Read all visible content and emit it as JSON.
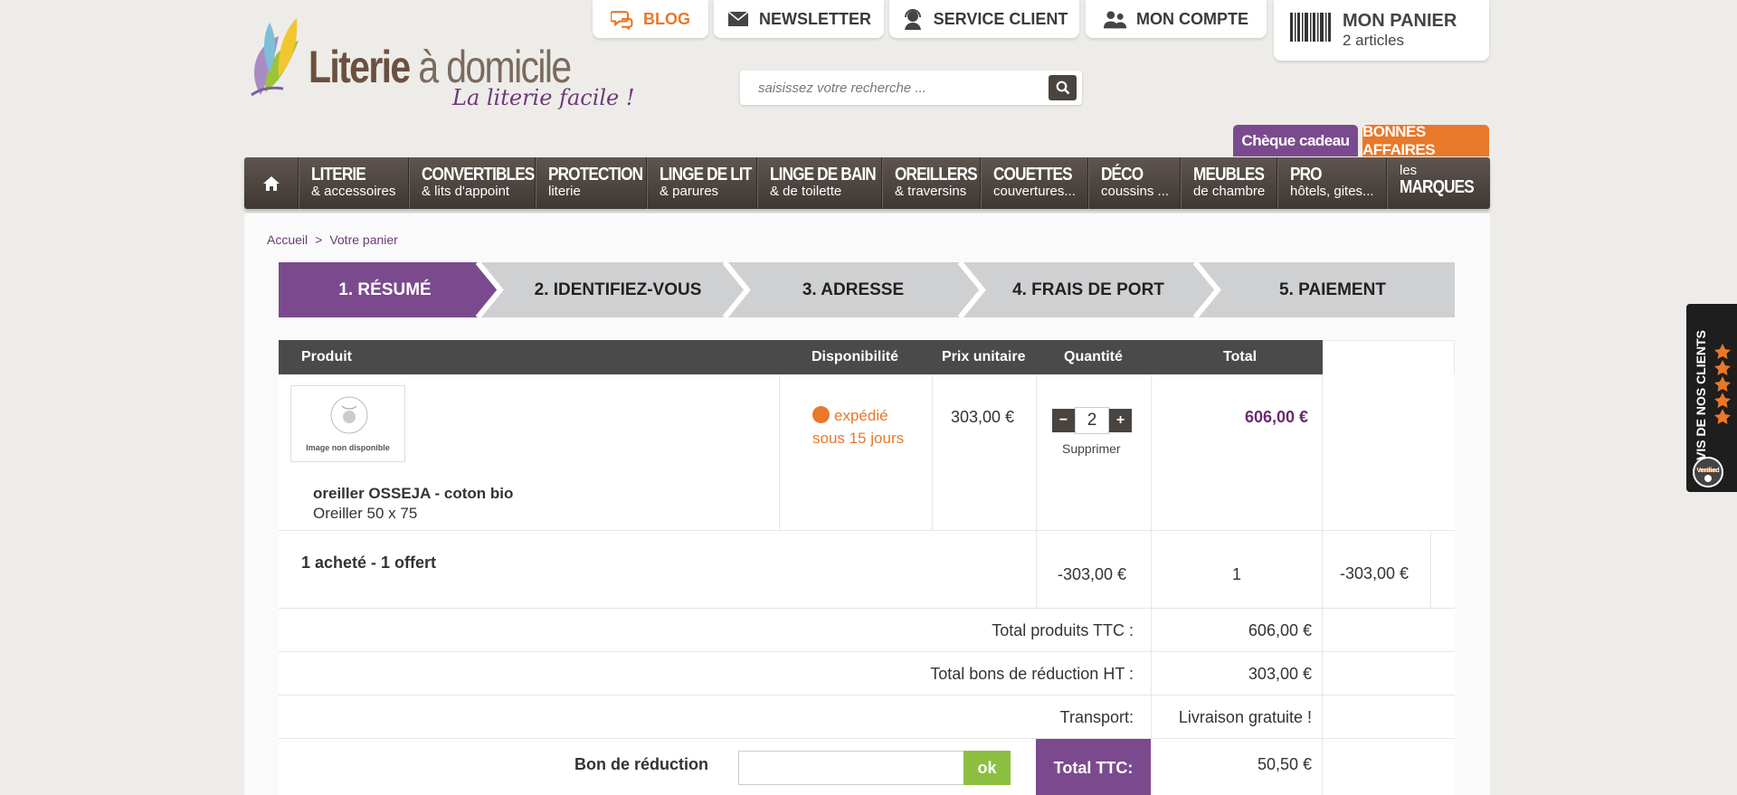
{
  "header": {
    "logo": {
      "main_bold": "Literie",
      "main_light": " à domicile",
      "tagline": "La literie facile !"
    },
    "top_links": [
      {
        "label": "BLOG",
        "icon": "chat-bubbles-icon"
      },
      {
        "label": "NEWSLETTER",
        "icon": "envelope-icon"
      },
      {
        "label": "SERVICE CLIENT",
        "icon": "headset-agent-icon"
      },
      {
        "label": "MON COMPTE",
        "icon": "users-icon"
      }
    ],
    "cart": {
      "title": "MON PANIER",
      "count": "2 articles",
      "icon": "barcode-icon"
    },
    "search": {
      "placeholder": "saisissez votre recherche ...",
      "icon": "search-icon"
    },
    "promo": {
      "gift": "Chèque cadeau",
      "deals": "BONNES AFFAIRES"
    }
  },
  "menu": {
    "home_icon": "home-icon",
    "items": [
      {
        "title": "LITERIE",
        "sub": "& accessoires"
      },
      {
        "title": "CONVERTIBLES",
        "sub": "& lits d'appoint"
      },
      {
        "title": "PROTECTION",
        "sub": "literie"
      },
      {
        "title": "LINGE DE LIT",
        "sub": "& parures"
      },
      {
        "title": "LINGE DE BAIN",
        "sub": "& de toilette"
      },
      {
        "title": "OREILLERS",
        "sub": "& traversins"
      },
      {
        "title": "COUETTES",
        "sub": "couvertures..."
      },
      {
        "title": "DÉCO",
        "sub": "coussins ..."
      },
      {
        "title": "MEUBLES",
        "sub": "de chambre"
      },
      {
        "title": "PRO",
        "sub": "hôtels, gites..."
      }
    ],
    "brands": {
      "pre": "les",
      "title": "MARQUES"
    }
  },
  "breadcrumb": {
    "home": "Accueil",
    "separator": ">",
    "current": "Votre panier"
  },
  "steps": [
    "1. RÉSUMÉ",
    "2. IDENTIFIEZ-VOUS",
    "3. ADRESSE",
    "4. FRAIS DE PORT",
    "5. PAIEMENT"
  ],
  "table": {
    "headers": {
      "product": "Produit",
      "availability": "Disponibilité",
      "unit_price": "Prix unitaire",
      "quantity": "Quantité",
      "total": "Total"
    },
    "item": {
      "image_caption": "Image non disponible",
      "name": "oreiller OSSEJA - coton bio",
      "variant": "Oreiller 50 x 75",
      "availability_line1": "expédié",
      "availability_line2": "sous 15 jours",
      "unit_price": "303,00 €",
      "quantity": "2",
      "minus": "−",
      "plus": "+",
      "remove": "Supprimer",
      "total": "606,00 €"
    },
    "discount": {
      "label": "1 acheté - 1 offert",
      "price": "-303,00 €",
      "qty": "1",
      "total": "-303,00 €"
    },
    "summary": {
      "products_label": "Total produits TTC :",
      "products_value": "606,00 €",
      "vouchers_label": "Total bons de réduction HT :",
      "vouchers_value": "303,00 €",
      "shipping_label": "Transport:",
      "shipping_value": "Livraison gratuite !",
      "voucher_field_label": "Bon de réduction",
      "voucher_ok": "ok",
      "total_label": "Total TTC:",
      "total_value": "50,50 €"
    }
  },
  "reviews_widget": {
    "label": "AVIS DE NOS CLIENTS",
    "rating_stars": 5,
    "badge": "Verified"
  },
  "colors": {
    "purple": "#7b4a8e",
    "orange": "#e8782a",
    "dark": "#4a4a4a",
    "green": "#8cbf3f"
  }
}
